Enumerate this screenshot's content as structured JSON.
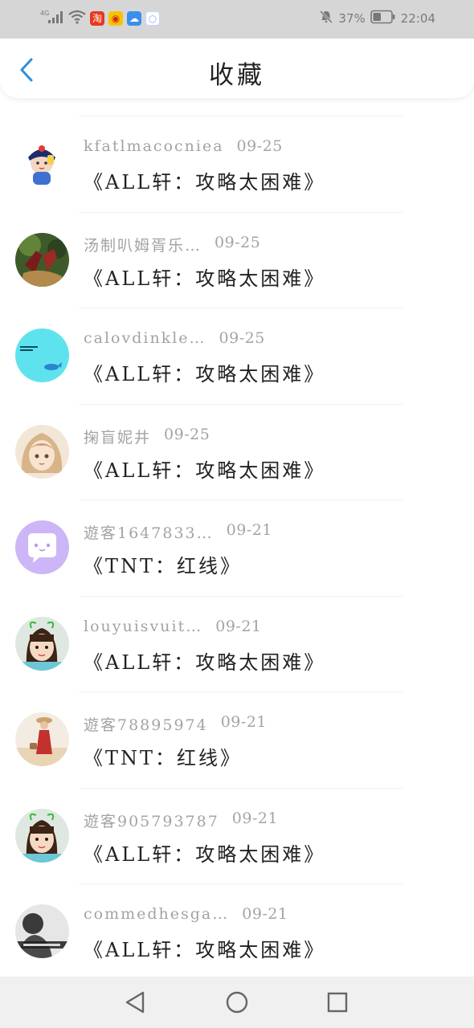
{
  "status_bar": {
    "network": "4G",
    "battery": "37%",
    "time": "22:04",
    "app_icons": [
      {
        "name": "taobao-app-icon",
        "glyph": "淘",
        "color": "#e8371f"
      },
      {
        "name": "weibo-app-icon",
        "glyph": "◉",
        "color": "#f0b400"
      },
      {
        "name": "cloud-app-icon",
        "glyph": "☁",
        "color": "#3a8ef0"
      },
      {
        "name": "ring-app-icon",
        "glyph": "○",
        "color": "#b6c9ff"
      }
    ]
  },
  "header": {
    "title": "收藏",
    "back_icon": "chevron-left-icon",
    "accent_color": "#2f8ee0"
  },
  "favorites": [
    {
      "user": "kfatlmacocniea",
      "date": "09-25",
      "title": "《ALL轩：攻略太困难》",
      "avatar": "cartoon-hat"
    },
    {
      "user": "汤制叭姆胥乐…",
      "date": "09-25",
      "title": "《ALL轩：攻略太困难》",
      "avatar": "photo-shoes"
    },
    {
      "user": "calovdinkle…",
      "date": "09-25",
      "title": "《ALL轩：攻略太困难》",
      "avatar": "cyan-whale"
    },
    {
      "user": "掬盲妮井",
      "date": "09-25",
      "title": "《ALL轩：攻略太困难》",
      "avatar": "anime-girl"
    },
    {
      "user": "遊客1647833…",
      "date": "09-21",
      "title": "《TNT：红线》",
      "avatar": "purple-chat"
    },
    {
      "user": "louyuisvuit…",
      "date": "09-21",
      "title": "《ALL轩：攻略太困难》",
      "avatar": "child-antenna"
    },
    {
      "user": "遊客78895974",
      "date": "09-21",
      "title": "《TNT：红线》",
      "avatar": "beach-woman"
    },
    {
      "user": "遊客905793787",
      "date": "09-21",
      "title": "《ALL轩：攻略太困难》",
      "avatar": "child-antenna"
    },
    {
      "user": "commedhesga…",
      "date": "09-21",
      "title": "《ALL轩：攻略太困难》",
      "avatar": "bw-photo"
    }
  ],
  "nav": {
    "back_icon": "triangle-back-icon",
    "home_icon": "circle-home-icon",
    "recent_icon": "square-recents-icon"
  }
}
